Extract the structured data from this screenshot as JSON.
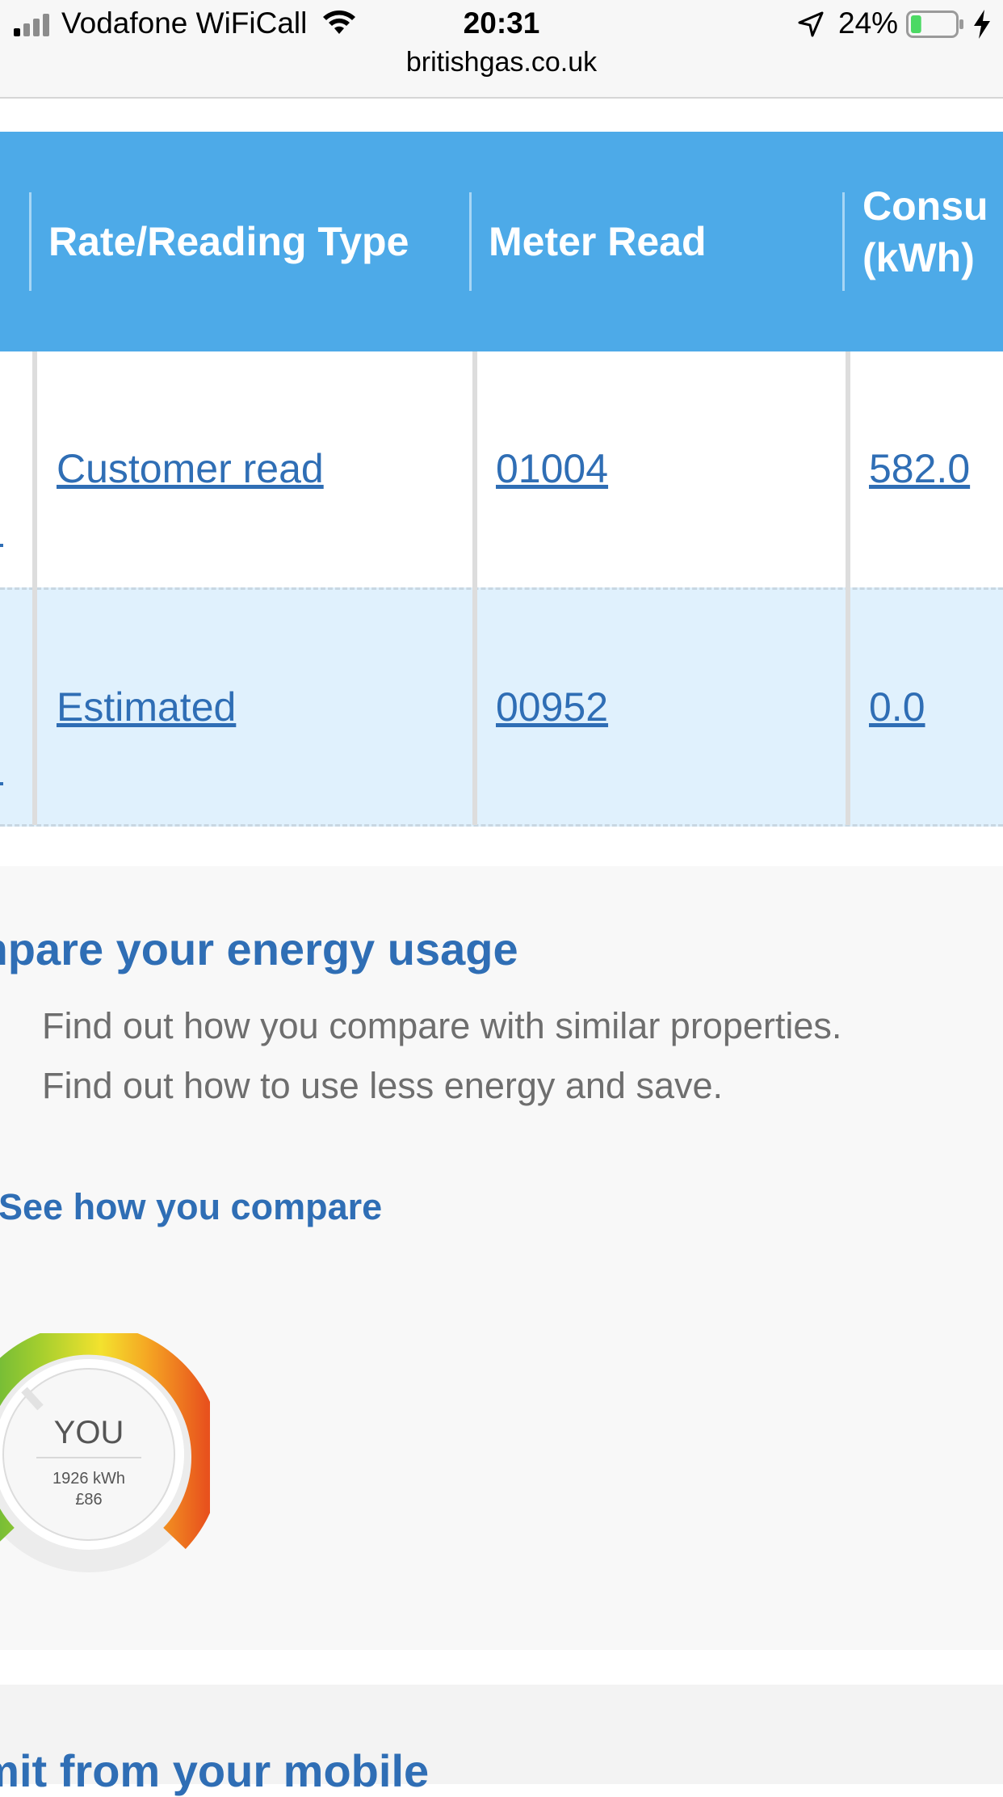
{
  "status_bar": {
    "carrier": "Vodafone WiFiCall",
    "time": "20:31",
    "battery_percent": "24%",
    "battery_level": 0.24,
    "url": "britishgas.co.uk",
    "icons": [
      "signal-icon",
      "wifi-icon",
      "location-arrow-icon",
      "battery-icon",
      "charging-bolt-icon"
    ]
  },
  "table": {
    "headers": [
      "Rate/Reading Type",
      "Meter Read",
      "Consu",
      "(kWh)"
    ],
    "rows": [
      {
        "type": "Customer read",
        "meter_read": "01004",
        "consumption": "582.0"
      },
      {
        "type": "Estimated",
        "meter_read": "00952",
        "consumption": "0.0"
      }
    ]
  },
  "compare": {
    "title": "mpare your energy usage",
    "lines": [
      "Find out how you compare with similar properties.",
      "Find out how to use less energy and save."
    ],
    "link": "See how you compare",
    "gauge": {
      "label": "YOU",
      "kwh": "1926 kWh",
      "cost": "£86"
    }
  },
  "submit": {
    "title": "bmit from your mobile"
  },
  "colors": {
    "header_blue": "#4daae8",
    "link_blue": "#2f6eb5",
    "row_alt": "#e0f1fd",
    "section_bg": "#f8f8f8"
  }
}
